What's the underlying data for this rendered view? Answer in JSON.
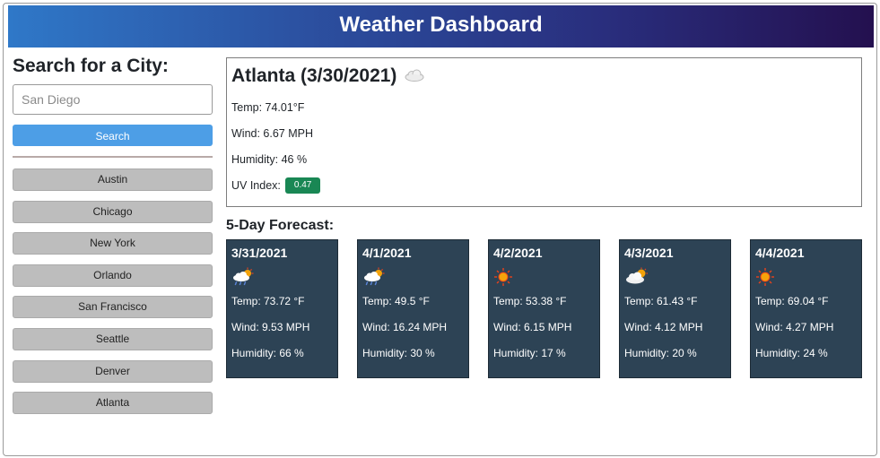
{
  "app": {
    "title": "Weather Dashboard"
  },
  "search": {
    "title": "Search for a City:",
    "placeholder": "San Diego",
    "button_label": "Search"
  },
  "history": [
    "Austin",
    "Chicago",
    "New York",
    "Orlando",
    "San Francisco",
    "Seattle",
    "Denver",
    "Atlanta"
  ],
  "current": {
    "heading": "Atlanta (3/30/2021)",
    "icon": "cloud-icon",
    "temp": "Temp: 74.01°F",
    "wind": "Wind: 6.67 MPH",
    "humidity": "Humidity: 46 %",
    "uv_label": "UV Index:",
    "uv_value": "0.47",
    "uv_color": "#198754"
  },
  "forecast": {
    "title": "5-Day Forecast:",
    "days": [
      {
        "date": "3/31/2021",
        "icon": "thunderstorm-sun-icon",
        "temp": "Temp: 73.72 °F",
        "wind": "Wind: 9.53 MPH",
        "humidity": "Humidity: 66 %"
      },
      {
        "date": "4/1/2021",
        "icon": "thunderstorm-sun-icon",
        "temp": "Temp: 49.5 °F",
        "wind": "Wind: 16.24 MPH",
        "humidity": "Humidity: 30 %"
      },
      {
        "date": "4/2/2021",
        "icon": "sun-icon",
        "temp": "Temp: 53.38 °F",
        "wind": "Wind: 6.15 MPH",
        "humidity": "Humidity: 17 %"
      },
      {
        "date": "4/3/2021",
        "icon": "cloud-sun-icon",
        "temp": "Temp: 61.43 °F",
        "wind": "Wind: 4.12 MPH",
        "humidity": "Humidity: 20 %"
      },
      {
        "date": "4/4/2021",
        "icon": "sun-icon",
        "temp": "Temp: 69.04 °F",
        "wind": "Wind: 4.27 MPH",
        "humidity": "Humidity: 24 %"
      }
    ]
  },
  "colors": {
    "header_start": "#2f78c8",
    "header_end": "#24104f",
    "search_button": "#4d9ee6",
    "history_button": "#bdbdbd",
    "card_background": "#2d4355"
  }
}
